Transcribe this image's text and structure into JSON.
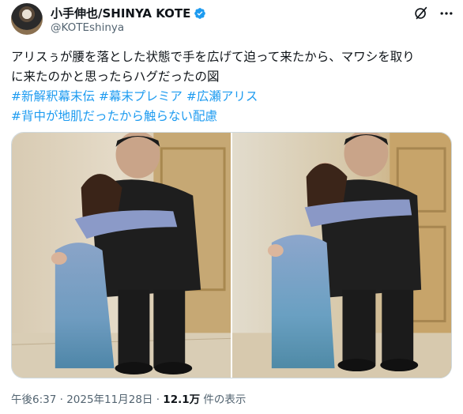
{
  "author": {
    "display_name": "小手伸也/SHINYA KOTE",
    "handle": "@KOTEshinya",
    "verified_icon": "verified-badge-icon",
    "verified_color": "#1d9bf0"
  },
  "header_icons": [
    "grok-icon",
    "more-icon"
  ],
  "tweet": {
    "lines": [
      [
        {
          "text": "アリスぅが腰を落とした状態で手を広げて迫って来たから、マワシを取り",
          "hashtag": false
        }
      ],
      [
        {
          "text": "に来たのかと思ったらハグだったの図",
          "hashtag": false
        }
      ],
      [
        {
          "text": "#新解釈幕末伝",
          "hashtag": true
        },
        {
          "text": " ",
          "hashtag": false
        },
        {
          "text": "#幕末プレミア",
          "hashtag": true
        },
        {
          "text": " ",
          "hashtag": false
        },
        {
          "text": "#広瀬アリス",
          "hashtag": true
        }
      ],
      [
        {
          "text": "#背中が地肌だったから触らない配慮",
          "hashtag": true
        }
      ]
    ],
    "hashtag_color": "#1d9bf0"
  },
  "media": {
    "photos": [
      {
        "name": "photo-1",
        "description_icon": "photo-icon"
      },
      {
        "name": "photo-2",
        "description_icon": "photo-icon"
      }
    ]
  },
  "meta": {
    "time": "午後6:37",
    "separator": " · ",
    "date": "2025年11月28日",
    "separator2": " · ",
    "views_count": "12.1万",
    "views_label": " 件の表示"
  }
}
